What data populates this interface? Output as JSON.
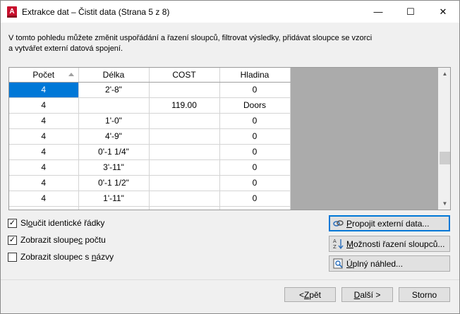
{
  "window": {
    "title": "Extrakce dat – Čistit data (Strana 5 z 8)",
    "app_icon_letter": "A",
    "minimize_glyph": "—",
    "maximize_glyph": "☐",
    "close_glyph": "✕"
  },
  "description": "V tomto pohledu můžete změnit uspořádání a řazení sloupců, filtrovat výsledky, přidávat sloupce se vzorci a vytvářet externí datová spojení.",
  "grid": {
    "columns": [
      "Počet",
      "Délka",
      "COST",
      "Hladina"
    ],
    "rows": [
      [
        "4",
        "2'-8\"",
        "",
        "0"
      ],
      [
        "4",
        "",
        "119.00",
        "Doors"
      ],
      [
        "4",
        "1'-0\"",
        "",
        "0"
      ],
      [
        "4",
        "4'-9\"",
        "",
        "0"
      ],
      [
        "4",
        "0'-1 1/4\"",
        "",
        "0"
      ],
      [
        "4",
        "3'-11\"",
        "",
        "0"
      ],
      [
        "4",
        "0'-1 1/2\"",
        "",
        "0"
      ],
      [
        "4",
        "1'-11\"",
        "",
        "0"
      ]
    ]
  },
  "checkboxes": [
    {
      "pre": "Sl",
      "key": "o",
      "post": "učit identické řádky",
      "checked": true
    },
    {
      "pre": "Zobrazit sloupe",
      "key": "c",
      "post": " počtu",
      "checked": true
    },
    {
      "pre": "Zobrazit sloupec s ",
      "key": "n",
      "post": "ázvy",
      "checked": false
    }
  ],
  "side_buttons": [
    {
      "pre": "",
      "key": "P",
      "post": "ropojit externí data...",
      "icon": "link-icon"
    },
    {
      "pre": "",
      "key": "M",
      "post": "ožnosti řazení sloupců...",
      "icon": "sort-icon"
    },
    {
      "pre": "",
      "key": "Ú",
      "post": "plný náhled...",
      "icon": "preview-icon"
    }
  ],
  "footer": {
    "back": {
      "pre": "< ",
      "key": "Z",
      "post": "pět"
    },
    "next": {
      "pre": "",
      "key": "D",
      "post": "alší >"
    },
    "cancel": "Storno"
  },
  "colors": {
    "selection": "#0078d7",
    "grid_background": "#ababab",
    "app_icon": "#c8102e"
  }
}
